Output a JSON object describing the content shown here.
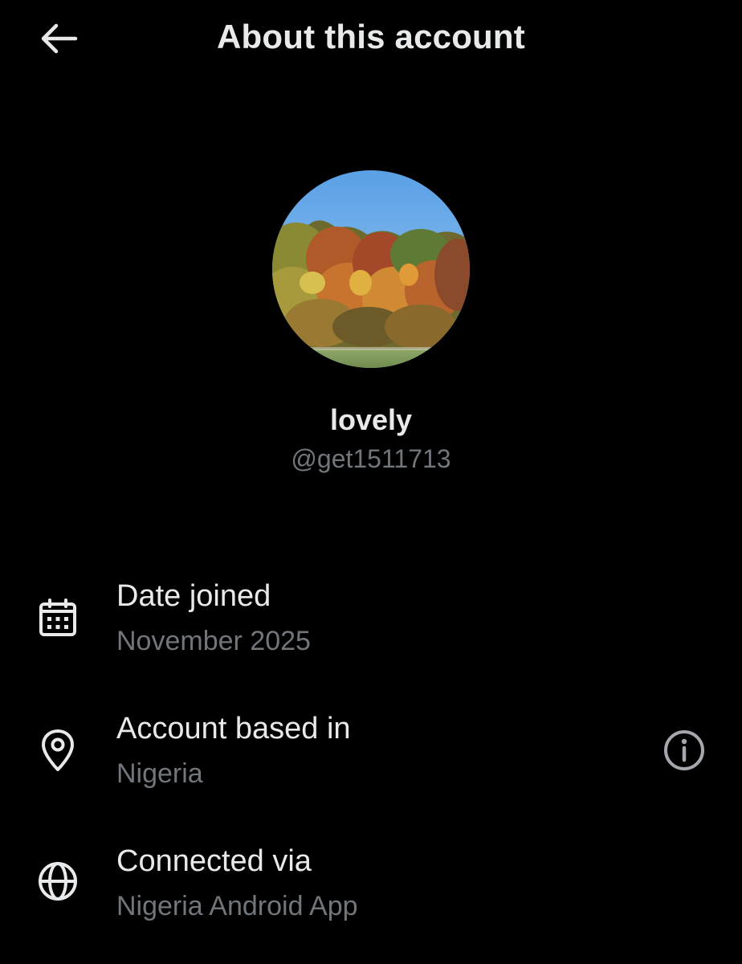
{
  "header": {
    "title": "About this account",
    "back_icon": "arrow-left-icon"
  },
  "profile": {
    "display_name": "lovely",
    "handle": "@get1511713",
    "avatar": "autumn-trees-photo"
  },
  "details": [
    {
      "label": "Date joined",
      "value": "November 2025",
      "icon": "calendar-icon"
    },
    {
      "label": "Account based in",
      "value": "Nigeria",
      "icon": "location-pin-icon",
      "info_icon": "info-icon"
    },
    {
      "label": "Connected via",
      "value": "Nigeria Android App",
      "icon": "globe-icon"
    }
  ],
  "colors": {
    "background": "#000000",
    "primary_text": "#e7e9ea",
    "secondary_text": "#71767b"
  }
}
